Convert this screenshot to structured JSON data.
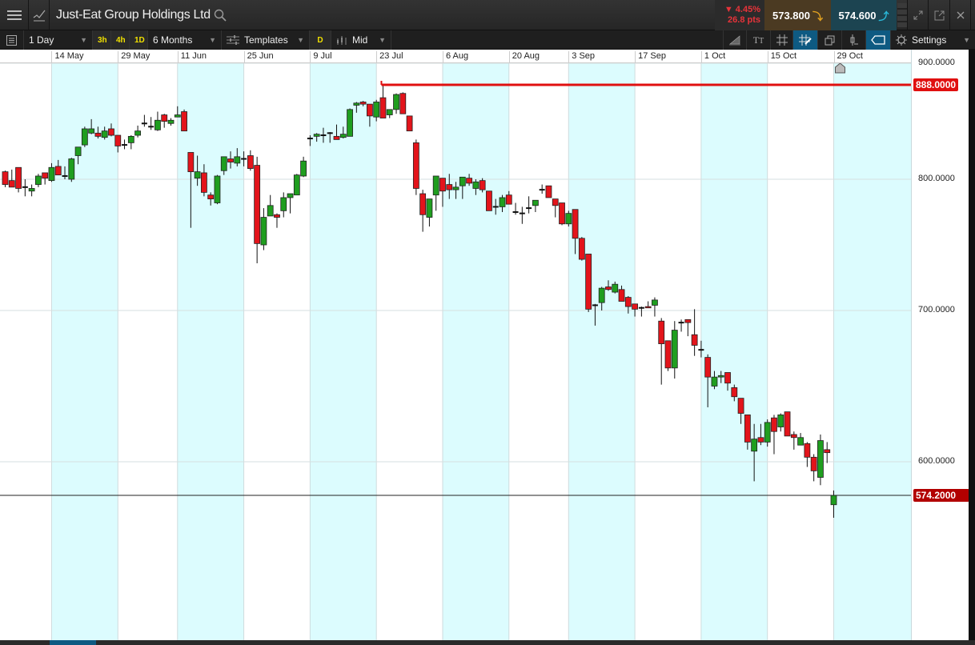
{
  "header": {
    "title": "Just-Eat Group Holdings Ltd",
    "change_pct": "▼ 4.45%",
    "change_pts": "26.8 pts",
    "sell_price": "573.800",
    "buy_price": "574.600"
  },
  "toolbar": {
    "interval": "1 Day",
    "quick": [
      "3h",
      "4h",
      "1D"
    ],
    "range": "6 Months",
    "templates": "Templates",
    "d_label": "D",
    "price_type": "Mid",
    "settings": "Settings"
  },
  "colors": {
    "up": "#1f9e1f",
    "down": "#e3141b",
    "band": "#dcfcfe",
    "hline": "#e01010",
    "last": "#b20000"
  },
  "chart_data": {
    "type": "candlestick",
    "scale": "log",
    "x_ticks": [
      {
        "label": "14 May",
        "index": 7
      },
      {
        "label": "29 May",
        "index": 17
      },
      {
        "label": "11 Jun",
        "index": 26
      },
      {
        "label": "25 Jun",
        "index": 36
      },
      {
        "label": "9 Jul",
        "index": 46
      },
      {
        "label": "23 Jul",
        "index": 56
      },
      {
        "label": "6 Aug",
        "index": 66
      },
      {
        "label": "20 Aug",
        "index": 76
      },
      {
        "label": "3 Sep",
        "index": 85
      },
      {
        "label": "17 Sep",
        "index": 95
      },
      {
        "label": "1 Oct",
        "index": 105
      },
      {
        "label": "15 Oct",
        "index": 115
      },
      {
        "label": "29 Oct",
        "index": 125
      }
    ],
    "y_ticks": [
      "900.0000",
      "800.0000",
      "700.0000",
      "600.0000"
    ],
    "y_tick_values": [
      900,
      800,
      700,
      600
    ],
    "horizontal_line": {
      "value": 888,
      "label": "888.0000",
      "start_index": 57
    },
    "last_price": {
      "value": 574.2,
      "label": "574.2000"
    },
    "ohlc": [
      [
        807,
        808,
        794,
        796
      ],
      [
        799,
        809,
        794,
        794
      ],
      [
        811,
        811,
        790,
        793
      ],
      [
        794,
        800,
        787,
        794
      ],
      [
        791,
        796,
        787,
        793
      ],
      [
        796,
        805,
        794,
        803
      ],
      [
        806,
        806,
        796,
        801
      ],
      [
        799,
        815,
        798,
        811
      ],
      [
        812,
        818,
        804,
        804
      ],
      [
        803,
        812,
        800,
        803
      ],
      [
        800,
        820,
        798,
        819
      ],
      [
        822,
        830,
        814,
        830
      ],
      [
        832,
        849,
        830,
        847
      ],
      [
        843,
        856,
        842,
        847
      ],
      [
        843,
        849,
        838,
        840
      ],
      [
        839,
        849,
        837,
        845
      ],
      [
        847,
        852,
        840,
        841
      ],
      [
        841,
        841,
        825,
        831
      ],
      [
        832,
        837,
        828,
        832
      ],
      [
        834,
        841,
        828,
        840
      ],
      [
        841,
        850,
        839,
        845
      ],
      [
        852,
        860,
        849,
        852
      ],
      [
        849,
        858,
        846,
        848
      ],
      [
        846,
        863,
        845,
        855
      ],
      [
        860,
        861,
        848,
        854
      ],
      [
        852,
        857,
        850,
        855
      ],
      [
        858,
        868,
        858,
        860
      ],
      [
        863,
        865,
        845,
        845
      ],
      [
        825,
        825,
        763,
        807
      ],
      [
        801,
        822,
        795,
        807
      ],
      [
        806,
        814,
        787,
        790
      ],
      [
        788,
        790,
        780,
        785
      ],
      [
        782,
        804,
        781,
        803
      ],
      [
        808,
        821,
        804,
        821
      ],
      [
        819,
        826,
        810,
        816
      ],
      [
        815,
        829,
        812,
        821
      ],
      [
        819,
        826,
        812,
        819
      ],
      [
        822,
        827,
        808,
        810
      ],
      [
        813,
        821,
        736,
        751
      ],
      [
        750,
        778,
        746,
        771
      ],
      [
        772,
        788,
        772,
        780
      ],
      [
        773,
        774,
        763,
        771
      ],
      [
        776,
        790,
        771,
        786
      ],
      [
        786,
        789,
        774,
        789
      ],
      [
        788,
        805,
        788,
        804
      ],
      [
        803,
        821,
        802,
        817
      ],
      [
        838,
        841,
        831,
        838
      ],
      [
        840,
        843,
        835,
        842
      ],
      [
        840,
        848,
        834,
        841
      ],
      [
        843,
        844,
        834,
        842
      ],
      [
        840,
        851,
        837,
        837
      ],
      [
        839,
        849,
        838,
        842
      ],
      [
        840,
        866,
        840,
        865
      ],
      [
        869,
        872,
        862,
        871
      ],
      [
        872,
        873,
        868,
        870
      ],
      [
        870,
        870,
        849,
        859
      ],
      [
        858,
        874,
        854,
        872
      ],
      [
        876,
        888,
        857,
        857
      ],
      [
        860,
        865,
        857,
        865
      ],
      [
        865,
        880,
        861,
        879
      ],
      [
        880,
        881,
        861,
        861
      ],
      [
        859,
        859,
        845,
        845
      ],
      [
        834,
        837,
        788,
        793
      ],
      [
        789,
        792,
        760,
        773
      ],
      [
        771,
        785,
        764,
        785
      ],
      [
        788,
        803,
        776,
        803
      ],
      [
        801,
        801,
        779,
        791
      ],
      [
        796,
        805,
        785,
        792
      ],
      [
        792,
        798,
        785,
        794
      ],
      [
        795,
        802,
        785,
        802
      ],
      [
        801,
        805,
        795,
        797
      ],
      [
        793,
        800,
        788,
        798
      ],
      [
        799,
        801,
        790,
        792
      ],
      [
        791,
        791,
        776,
        776
      ],
      [
        779,
        785,
        773,
        779
      ],
      [
        779,
        788,
        775,
        786
      ],
      [
        788,
        791,
        781,
        781
      ],
      [
        775,
        782,
        773,
        775
      ],
      [
        774,
        779,
        766,
        774
      ],
      [
        778,
        787,
        774,
        778
      ],
      [
        780,
        784,
        775,
        784
      ],
      [
        792,
        796,
        789,
        792
      ],
      [
        795,
        795,
        786,
        786
      ],
      [
        785,
        785,
        771,
        780
      ],
      [
        782,
        782,
        765,
        766
      ],
      [
        766,
        776,
        764,
        774
      ],
      [
        777,
        777,
        743,
        755
      ],
      [
        755,
        756,
        738,
        739
      ],
      [
        743,
        743,
        699,
        701
      ],
      [
        704,
        705,
        690,
        704
      ],
      [
        706,
        718,
        700,
        717
      ],
      [
        718,
        723,
        715,
        716
      ],
      [
        714,
        722,
        713,
        720
      ],
      [
        716,
        719,
        707,
        707
      ],
      [
        710,
        711,
        698,
        703
      ],
      [
        705,
        705,
        696,
        701
      ],
      [
        702,
        703,
        696,
        702
      ],
      [
        703,
        707,
        702,
        702
      ],
      [
        704,
        710,
        696,
        708
      ],
      [
        693,
        695,
        651,
        678
      ],
      [
        680,
        680,
        660,
        662
      ],
      [
        662,
        693,
        655,
        687
      ],
      [
        692,
        694,
        686,
        692
      ],
      [
        694,
        694,
        683,
        692
      ],
      [
        684,
        701,
        670,
        677
      ],
      [
        674,
        680,
        669,
        674
      ],
      [
        669,
        671,
        636,
        656
      ],
      [
        650,
        660,
        648,
        656
      ],
      [
        656,
        660,
        652,
        657
      ],
      [
        659,
        659,
        647,
        652
      ],
      [
        649,
        651,
        640,
        643
      ],
      [
        642,
        642,
        625,
        632
      ],
      [
        631,
        631,
        608,
        613
      ],
      [
        607,
        625,
        585,
        615
      ],
      [
        616,
        625,
        611,
        613
      ],
      [
        613,
        628,
        610,
        626
      ],
      [
        629,
        631,
        605,
        620
      ],
      [
        623,
        632,
        620,
        631
      ],
      [
        633,
        633,
        617,
        617
      ],
      [
        618,
        620,
        608,
        616
      ],
      [
        611,
        619,
        611,
        616
      ],
      [
        612,
        613,
        596,
        603
      ],
      [
        603,
        605,
        585,
        593
      ],
      [
        588,
        618,
        582,
        614
      ],
      [
        608,
        613,
        599,
        606
      ],
      [
        567,
        578,
        557,
        574.2
      ]
    ]
  }
}
